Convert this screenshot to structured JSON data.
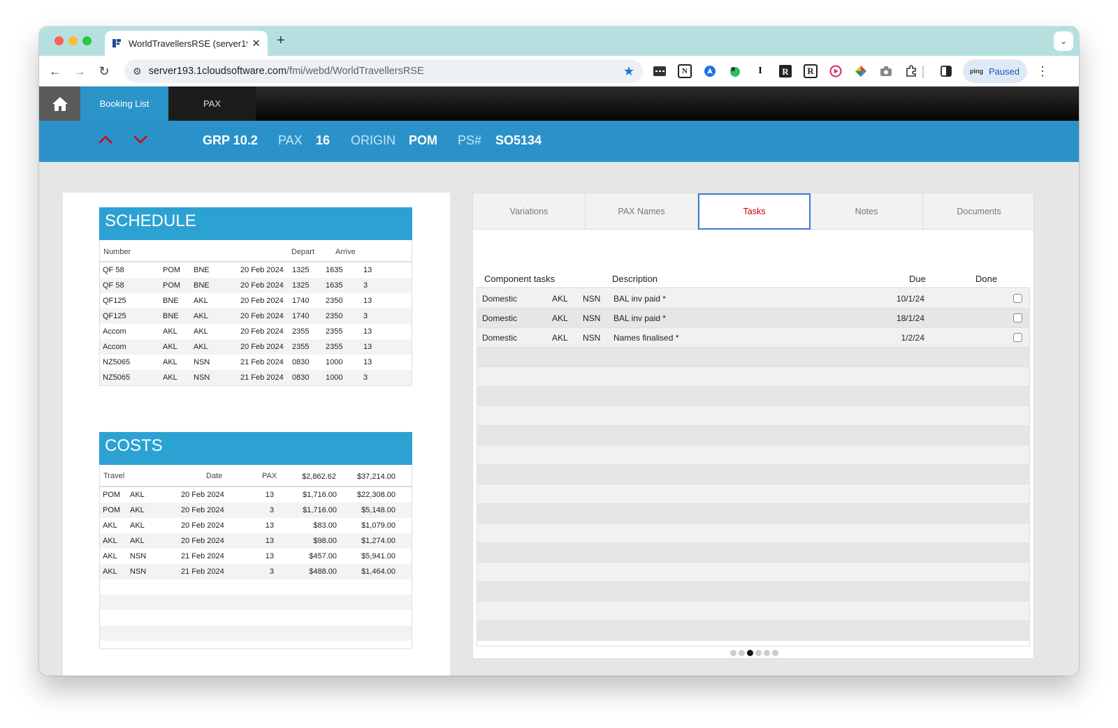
{
  "browser": {
    "tab_title": "WorldTravellersRSE (server19",
    "url_host": "server193.1cloudsoftware.com",
    "url_path": "/fmi/webd/WorldTravellersRSE",
    "profile_status": "Paused",
    "profile_badge": "ping"
  },
  "appnav": {
    "tabs": [
      {
        "label": "Booking List"
      },
      {
        "label": "PAX"
      }
    ]
  },
  "infobar": {
    "group": "GRP 10.2",
    "pax_label": "PAX",
    "pax_value": "16",
    "origin_label": "ORIGIN",
    "origin_value": "POM",
    "ps_label": "PS#",
    "ps_value": "SO5134"
  },
  "schedule": {
    "title": "SCHEDULE",
    "headers": {
      "number": "Number",
      "depart": "Depart",
      "arrive": "Arrive"
    },
    "rows": [
      [
        "QF 58",
        "POM",
        "BNE",
        "20 Feb 2024",
        "1325",
        "1635",
        "13"
      ],
      [
        "QF 58",
        "POM",
        "BNE",
        "20 Feb 2024",
        "1325",
        "1635",
        "3"
      ],
      [
        "QF125",
        "BNE",
        "AKL",
        "20 Feb 2024",
        "1740",
        "2350",
        "13"
      ],
      [
        "QF125",
        "BNE",
        "AKL",
        "20 Feb 2024",
        "1740",
        "2350",
        "3"
      ],
      [
        "Accom",
        "AKL",
        "AKL",
        "20 Feb 2024",
        "2355",
        "2355",
        "13"
      ],
      [
        "Accom",
        "AKL",
        "AKL",
        "20 Feb 2024",
        "2355",
        "2355",
        "13"
      ],
      [
        "NZ5065",
        "AKL",
        "NSN",
        "21 Feb 2024",
        "0830",
        "1000",
        "13"
      ],
      [
        "NZ5065",
        "AKL",
        "NSN",
        "21 Feb 2024",
        "0830",
        "1000",
        "3"
      ]
    ]
  },
  "costs": {
    "title": "COSTS",
    "headers": {
      "travel": "Travel",
      "date": "Date",
      "pax": "PAX",
      "total_unit": "$2,862.62",
      "total_all": "$37,214.00"
    },
    "rows": [
      [
        "POM",
        "AKL",
        "20 Feb 2024",
        "13",
        "$1,716.00",
        "$22,308.00"
      ],
      [
        "POM",
        "AKL",
        "20 Feb 2024",
        "3",
        "$1,716.00",
        "$5,148.00"
      ],
      [
        "AKL",
        "AKL",
        "20 Feb 2024",
        "13",
        "$83.00",
        "$1,079.00"
      ],
      [
        "AKL",
        "AKL",
        "20 Feb 2024",
        "13",
        "$98.00",
        "$1,274.00"
      ],
      [
        "AKL",
        "NSN",
        "21 Feb 2024",
        "13",
        "$457.00",
        "$5,941.00"
      ],
      [
        "AKL",
        "NSN",
        "21 Feb 2024",
        "3",
        "$488.00",
        "$1,464.00"
      ]
    ]
  },
  "right_tabs": [
    {
      "label": "Variations"
    },
    {
      "label": "PAX Names"
    },
    {
      "label": "Tasks"
    },
    {
      "label": "Notes"
    },
    {
      "label": "Documents"
    }
  ],
  "tasks": {
    "headers": {
      "component": "Component tasks",
      "description": "Description",
      "due": "Due",
      "done": "Done"
    },
    "rows": [
      [
        "Domestic",
        "AKL",
        "NSN",
        "BAL inv paid *",
        "10/1/24"
      ],
      [
        "Domestic",
        "AKL",
        "NSN",
        "BAL inv paid *",
        "18/1/24"
      ],
      [
        "Domestic",
        "AKL",
        "NSN",
        "Names finalised *",
        "1/2/24"
      ]
    ]
  }
}
